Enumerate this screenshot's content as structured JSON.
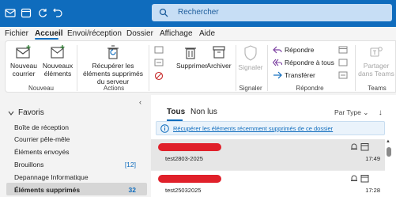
{
  "titlebar": {
    "search_placeholder": "Rechercher",
    "accent": "#0f6cbd"
  },
  "ribbon_tabs": [
    "Fichier",
    "Accueil",
    "Envoi/réception",
    "Dossier",
    "Affichage",
    "Aide"
  ],
  "ribbon": {
    "new_mail": "Nouveau courrier",
    "new_items": "Nouveaux éléments",
    "group_new": "Nouveau",
    "recover": "Récupérer les éléments supprimés du serveur",
    "group_actions": "Actions",
    "delete": "Supprimer",
    "archive": "Archiver",
    "report": "Signaler",
    "group_report": "Signaler",
    "reply": "Répondre",
    "reply_all": "Répondre à tous",
    "forward": "Transférer",
    "group_respond": "Répondre",
    "share_teams": "Partager dans Teams",
    "group_teams": "Teams"
  },
  "folders": {
    "favorites_label": "Favoris",
    "items": [
      {
        "label": "Boîte de réception",
        "count": ""
      },
      {
        "label": "Courrier pêle-mêle",
        "count": ""
      },
      {
        "label": "Éléments envoyés",
        "count": ""
      },
      {
        "label": "Brouillons",
        "count": "[12]"
      },
      {
        "label": "Depannage Informatique",
        "count": ""
      },
      {
        "label": "Éléments supprimés",
        "count": "32"
      }
    ]
  },
  "list": {
    "tab_all": "Tous",
    "tab_unread": "Non lus",
    "sort_label": "Par Type",
    "info_text": "Récupérer les éléments récemment supprimés de ce dossier",
    "messages": [
      {
        "subject": "test2803-2025",
        "time": "17:49"
      },
      {
        "subject": "test25032025",
        "time": "17:28"
      }
    ]
  }
}
